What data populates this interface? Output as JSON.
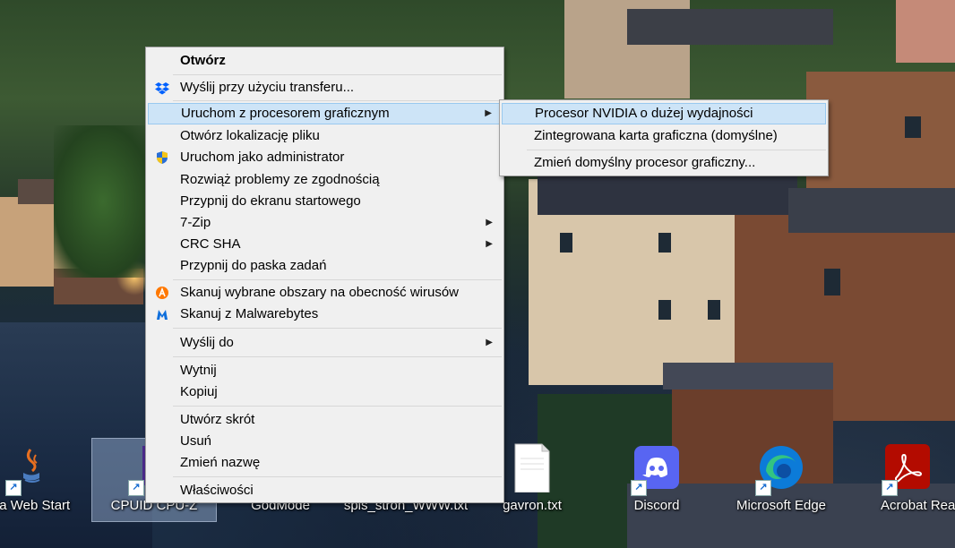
{
  "desktop": {
    "icons": [
      {
        "label": "va Web Start",
        "icon": "java-icon"
      },
      {
        "label": "CPUID CPU-Z",
        "icon": "cpuz-icon"
      },
      {
        "label": "GodMode",
        "icon": "folder-icon"
      },
      {
        "label": "spis_stron_WWW.txt",
        "icon": "text-file-icon"
      },
      {
        "label": "gavron.txt",
        "icon": "text-file-icon"
      },
      {
        "label": "Discord",
        "icon": "discord-icon"
      },
      {
        "label": "Microsoft Edge",
        "icon": "edge-icon"
      },
      {
        "label": "Acrobat Reader D",
        "icon": "acrobat-icon"
      }
    ]
  },
  "context_menu": {
    "items": [
      {
        "label": "Otwórz",
        "bold": true
      },
      {
        "label": "Wyślij przy użyciu transferu...",
        "icon": "dropbox-icon"
      },
      {
        "label": "Uruchom z procesorem graficznym",
        "submenu": true,
        "highlighted": true
      },
      {
        "label": "Otwórz lokalizację pliku"
      },
      {
        "label": "Uruchom jako administrator",
        "icon": "uac-shield-icon"
      },
      {
        "label": "Rozwiąż problemy ze zgodnością"
      },
      {
        "label": "Przypnij do ekranu startowego"
      },
      {
        "label": "7-Zip",
        "submenu": true
      },
      {
        "label": "CRC SHA",
        "submenu": true
      },
      {
        "label": "Przypnij do paska zadań"
      },
      {
        "label": "Skanuj wybrane obszary na obecność wirusów",
        "icon": "avast-icon"
      },
      {
        "label": "Skanuj z Malwarebytes",
        "icon": "malwarebytes-icon"
      },
      {
        "label": "Wyślij do",
        "submenu": true
      },
      {
        "label": "Wytnij"
      },
      {
        "label": "Kopiuj"
      },
      {
        "label": "Utwórz skrót"
      },
      {
        "label": "Usuń"
      },
      {
        "label": "Zmień nazwę"
      },
      {
        "label": "Właściwości"
      }
    ]
  },
  "gpu_submenu": {
    "items": [
      {
        "label": "Procesor NVIDIA o dużej wydajności",
        "highlighted": true
      },
      {
        "label": "Zintegrowana karta graficzna (domyślne)"
      },
      {
        "label": "Zmień domyślny procesor graficzny..."
      }
    ]
  },
  "colors": {
    "menu_bg": "#f0f0f0",
    "highlight_bg": "#cde4f7",
    "highlight_border": "#99c9ef"
  }
}
